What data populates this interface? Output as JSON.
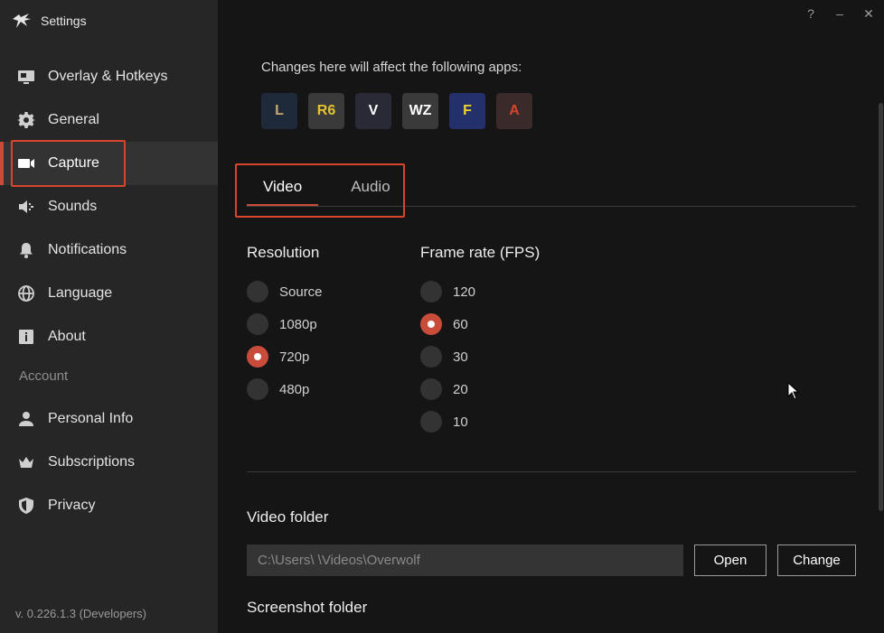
{
  "app": {
    "title": "Settings"
  },
  "window_controls": {
    "help": "?",
    "minimize": "–",
    "close": "✕"
  },
  "sidebar": {
    "items": [
      {
        "label": "Overlay & Hotkeys",
        "icon": "monitor-icon"
      },
      {
        "label": "General",
        "icon": "gear-icon"
      },
      {
        "label": "Capture",
        "icon": "video-camera-icon"
      },
      {
        "label": "Sounds",
        "icon": "speaker-icon"
      },
      {
        "label": "Notifications",
        "icon": "bell-icon"
      },
      {
        "label": "Language",
        "icon": "globe-icon"
      },
      {
        "label": "About",
        "icon": "info-icon"
      }
    ],
    "account_label": "Account",
    "account_items": [
      {
        "label": "Personal Info",
        "icon": "person-icon"
      },
      {
        "label": "Subscriptions",
        "icon": "crown-icon"
      },
      {
        "label": "Privacy",
        "icon": "shield-icon"
      }
    ],
    "active_item": "Capture",
    "version": "v. 0.226.1.3 (Developers)"
  },
  "main": {
    "apps_note": "Changes here will affect the following apps:",
    "app_icons": [
      {
        "text": "L",
        "icon": "league-app-icon",
        "color": "#c8aa6e"
      },
      {
        "text": "R6",
        "icon": "rainbow-six-app-icon",
        "color": "#e5c430"
      },
      {
        "text": "V",
        "icon": "valorant-app-icon",
        "color": "#ffffff"
      },
      {
        "text": "WZ",
        "icon": "warzone-app-icon",
        "color": "#ffffff"
      },
      {
        "text": "F",
        "icon": "fortnite-app-icon",
        "color": "#f5d22c"
      },
      {
        "text": "A",
        "icon": "apex-app-icon",
        "color": "#d8452f"
      }
    ],
    "tabs": [
      {
        "label": "Video",
        "active": true
      },
      {
        "label": "Audio",
        "active": false
      }
    ],
    "resolution": {
      "title": "Resolution",
      "options": [
        "Source",
        "1080p",
        "720p",
        "480p"
      ],
      "selected": "720p"
    },
    "frame_rate": {
      "title": "Frame rate (FPS)",
      "options": [
        "120",
        "60",
        "30",
        "20",
        "10"
      ],
      "selected": "60"
    },
    "video_folder": {
      "title": "Video folder",
      "path": "C:\\Users\\        \\Videos\\Overwolf",
      "open_label": "Open",
      "change_label": "Change"
    },
    "screenshot_folder": {
      "title": "Screenshot folder"
    }
  },
  "colors": {
    "accent": "#c94c3a",
    "highlight_box": "#d8452f",
    "sidebar_bg": "#262626",
    "main_bg": "#151515"
  }
}
